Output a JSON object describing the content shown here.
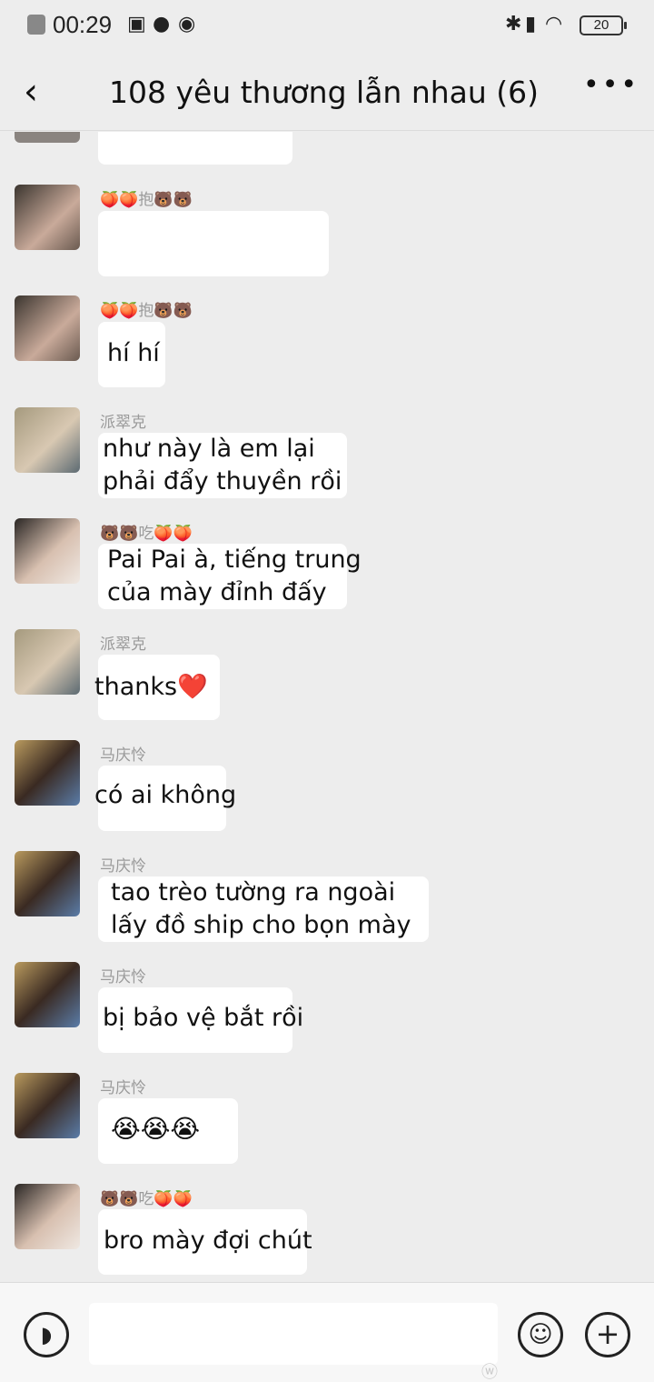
{
  "status_bar": {
    "time": "00:29",
    "battery": "20",
    "icons": [
      "close-notification-icon",
      "screenshot-icon",
      "wechat-icon",
      "browser-icon",
      "bluetooth-icon",
      "vibrate-icon",
      "wifi-icon"
    ]
  },
  "header": {
    "back_icon": "‹",
    "title": "108 yêu thương lẫn nhau (6)",
    "more_icon": "•••"
  },
  "messages": [
    {
      "sender": "",
      "lines": [
        ""
      ]
    },
    {
      "sender": "🍑🍑抱🐻🐻",
      "lines": [
        ""
      ]
    },
    {
      "sender": "🍑🍑抱🐻🐻",
      "lines": [
        "hí hí"
      ]
    },
    {
      "sender": "派翠克",
      "lines": [
        "như này là em lại",
        "phải đẩy thuyền rồi"
      ]
    },
    {
      "sender": "🐻🐻吃🍑🍑",
      "lines": [
        "Pai Pai à, tiếng trung",
        "của mày đỉnh đấy"
      ]
    },
    {
      "sender": "派翠克",
      "lines": [
        "thanks❤️"
      ]
    },
    {
      "sender": "马庆怜",
      "lines": [
        "có ai không"
      ]
    },
    {
      "sender": "马庆怜",
      "lines": [
        "tao trèo tường ra ngoài",
        "lấy đồ ship cho bọn mày"
      ]
    },
    {
      "sender": "马庆怜",
      "lines": [
        "bị bảo vệ bắt rồi"
      ]
    },
    {
      "sender": "马庆怜",
      "lines": [
        "😭😭😭"
      ]
    },
    {
      "sender": "🐻🐻吃🍑🍑",
      "lines": [
        "bro mày đợi chút"
      ]
    }
  ],
  "input_bar": {
    "voice_icon": "voice-icon",
    "emoji_icon": "emoji-icon",
    "plus_icon": "plus-icon"
  }
}
